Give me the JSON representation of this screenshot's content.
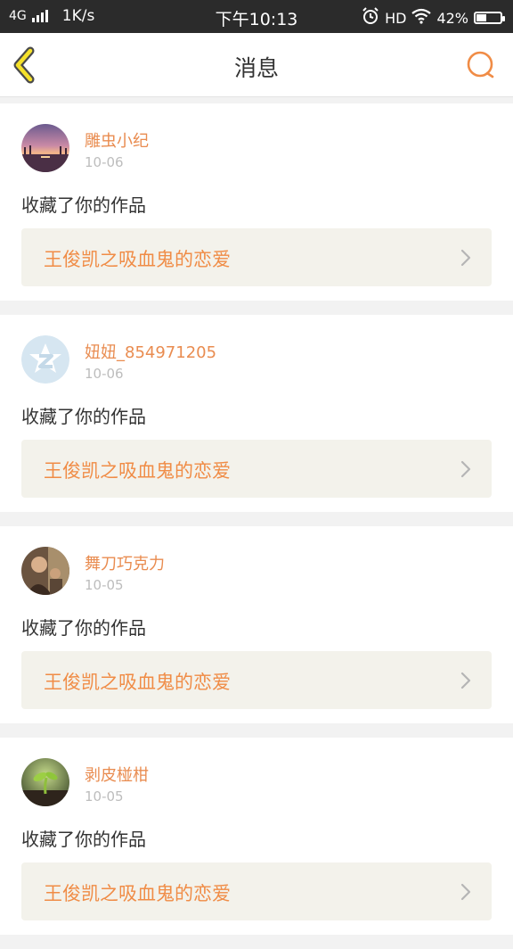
{
  "status_bar": {
    "network": "4G",
    "speed": "1K/s",
    "time": "下午10:13",
    "hd": "HD",
    "battery": "42%",
    "battery_level": 0.42,
    "icons": [
      "signal-icon",
      "alarm-icon",
      "wifi-icon",
      "battery-icon"
    ]
  },
  "header": {
    "title": "消息",
    "back_icon": "chevron-left-icon",
    "search_icon": "search-icon"
  },
  "colors": {
    "accent": "#f08c46",
    "username": "#e98c50",
    "back_arrow_stroke": "#4a4a4a",
    "back_arrow_fill": "#f5e12a",
    "link_bg": "#f3f2eb"
  },
  "messages": [
    {
      "avatar": "sunset-photo-avatar",
      "name": "雕虫小纪",
      "time": "10-06",
      "action": "收藏了你的作品",
      "work_title": "王俊凯之吸血鬼的恋爱"
    },
    {
      "avatar": "default-q-avatar",
      "name": "妞妞_854971205",
      "time": "10-06",
      "action": "收藏了你的作品",
      "work_title": "王俊凯之吸血鬼的恋爱"
    },
    {
      "avatar": "people-photo-avatar",
      "name": "舞刀巧克力",
      "time": "10-05",
      "action": "收藏了你的作品",
      "work_title": "王俊凯之吸血鬼的恋爱"
    },
    {
      "avatar": "sprout-photo-avatar",
      "name": "剥皮椪柑",
      "time": "10-05",
      "action": "收藏了你的作品",
      "work_title": "王俊凯之吸血鬼的恋爱"
    }
  ]
}
